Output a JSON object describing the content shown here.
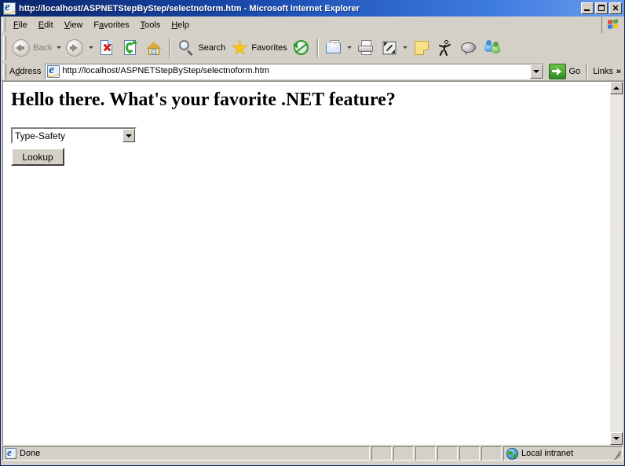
{
  "window": {
    "title": "http://localhost/ASPNETStepByStep/selectnoform.htm - Microsoft Internet Explorer",
    "icon": "ie-logo-icon",
    "controls": {
      "minimize": "_",
      "maximize": "□",
      "close": "✕"
    }
  },
  "menubar": {
    "items": [
      {
        "label": "File",
        "accel": "F",
        "rest": "ile",
        "pre": ""
      },
      {
        "label": "Edit",
        "accel": "E",
        "rest": "dit",
        "pre": ""
      },
      {
        "label": "View",
        "accel": "V",
        "rest": "iew",
        "pre": ""
      },
      {
        "label": "Favorites",
        "accel": "a",
        "rest": "vorites",
        "pre": "F"
      },
      {
        "label": "Tools",
        "accel": "T",
        "rest": "ools",
        "pre": ""
      },
      {
        "label": "Help",
        "accel": "H",
        "rest": "elp",
        "pre": ""
      }
    ],
    "brand_logo": "windows-flag-icon"
  },
  "toolbar": {
    "back_label": "Back",
    "back_enabled": false,
    "forward_label": "",
    "search_label": "Search",
    "favorites_label": "Favorites",
    "buttons": [
      "back-button",
      "forward-button",
      "stop-button",
      "refresh-button",
      "home-button",
      "search-button",
      "favorites-button",
      "history-button",
      "mail-button",
      "print-button",
      "edit-button",
      "notes-button",
      "messenger-button",
      "discuss-button",
      "msn-button"
    ]
  },
  "addressbar": {
    "label": "Address",
    "label_pre": "A",
    "label_accel": "d",
    "label_rest": "dress",
    "url": "http://localhost/ASPNETStepByStep/selectnoform.htm",
    "icon": "ie-logo-icon",
    "go_label": "Go",
    "links_label": "Links",
    "links_chevron": "»"
  },
  "page": {
    "heading": "Hello there. What's your favorite .NET feature?",
    "select": {
      "selected": "Type-Safety",
      "options": [
        "Type-Safety"
      ]
    },
    "button_label": "Lookup"
  },
  "statusbar": {
    "status_text": "Done",
    "status_icon": "ie-logo-icon",
    "zone_text": "Local intranet",
    "zone_icon": "globe-icon",
    "empty_panels": 6
  },
  "colors": {
    "titlebar_start": "#0a246a",
    "titlebar_end": "#6a9ceb",
    "chrome": "#d4d0c8",
    "page_background": "#ffffff",
    "accent_green": "#2f8a22"
  }
}
